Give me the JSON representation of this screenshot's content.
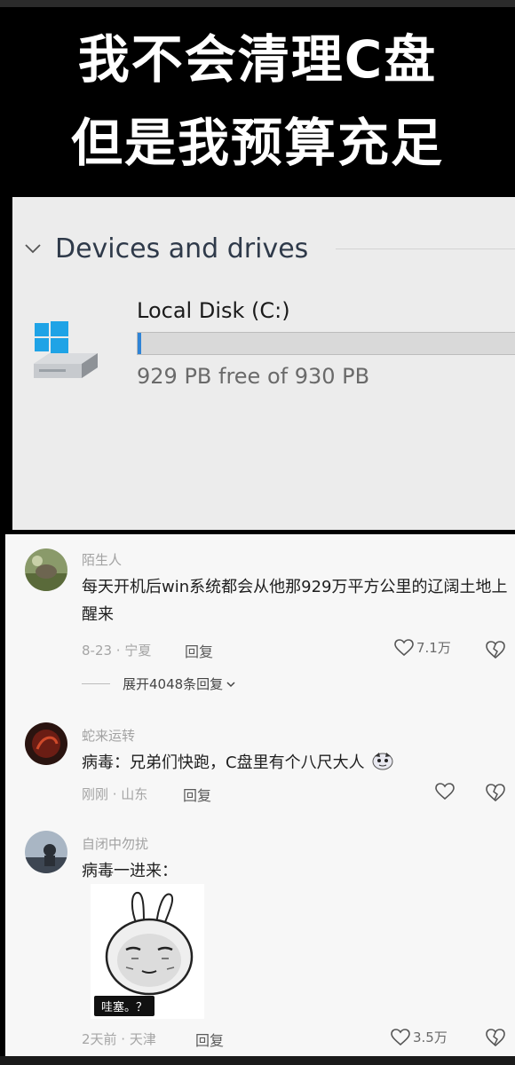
{
  "meme": {
    "title_line1": "我不会清理C盘",
    "title_line2": "但是我预算充足"
  },
  "explorer": {
    "section_title": "Devices and drives",
    "drive": {
      "name": "Local Disk (C:)",
      "free_text": "929 PB free of 930 PB",
      "used_fraction": 0.0011
    },
    "colors": {
      "accent": "#2f84d6",
      "windows_logo": "#1fa3e6"
    }
  },
  "comments": [
    {
      "username": "陌生人",
      "text": "每天开机后win系统都会从他那929万平方公里的辽阔土地上醒来",
      "date_location": "8-23 · 宁夏",
      "reply_label": "回复",
      "likes": "7.1万",
      "expand_label": "展开4048条回复"
    },
    {
      "username": "蛇来运转",
      "text": "病毒：兄弟们快跑，C盘里有个八尺大人",
      "date_location": "刚刚 · 山东",
      "reply_label": "回复",
      "likes": ""
    },
    {
      "username": "自闭中勿扰",
      "text": "病毒一进来：",
      "date_location": "2天前 · 天津",
      "reply_label": "回复",
      "likes": "3.5万",
      "meme_caption": "哇塞。？"
    }
  ]
}
